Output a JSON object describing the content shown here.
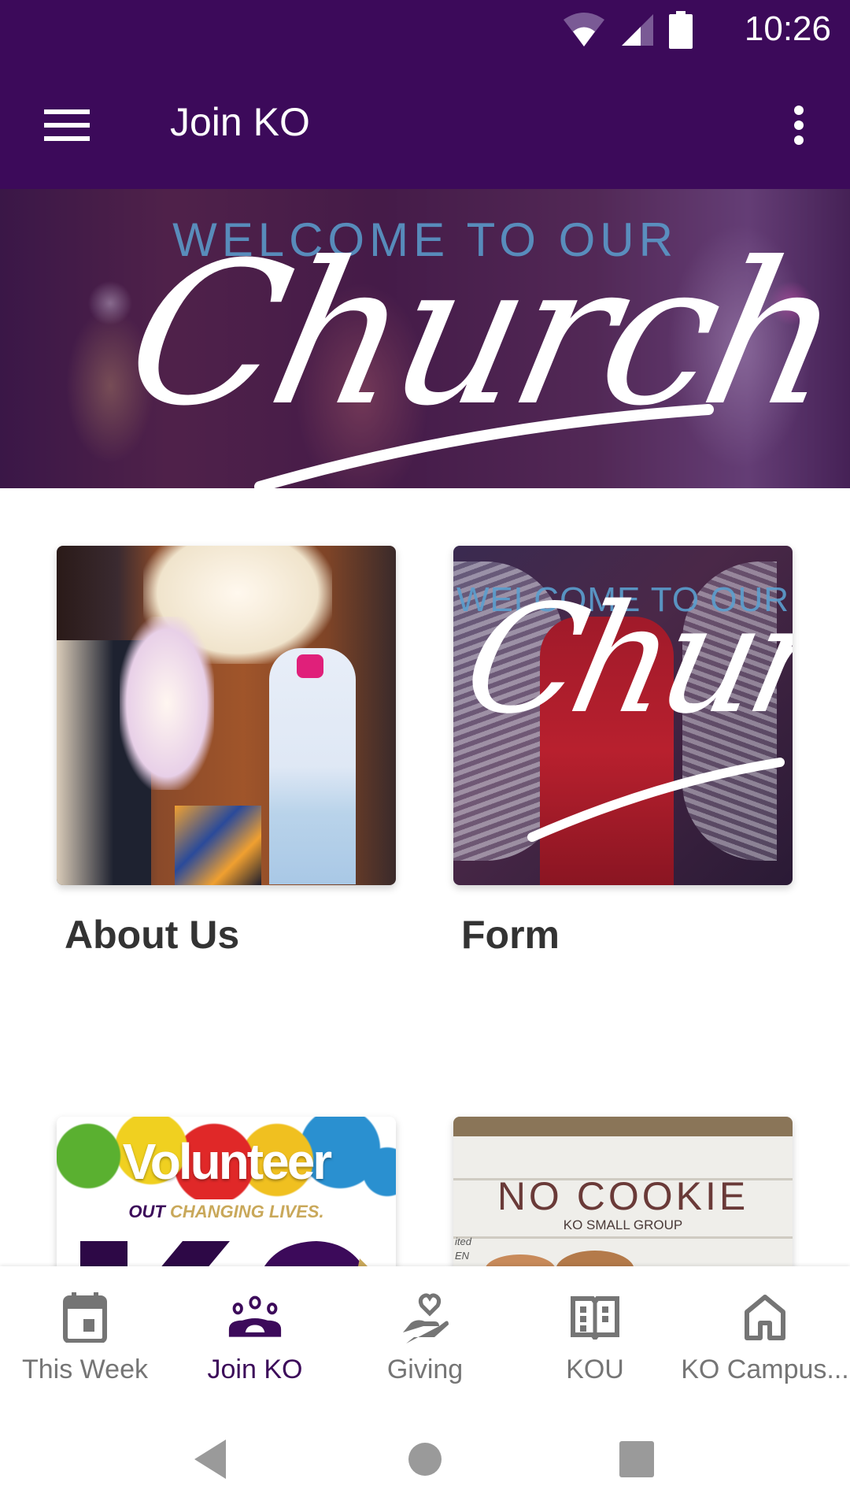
{
  "status_bar": {
    "time": "10:26",
    "icons": [
      "wifi-icon",
      "cellular-signal-icon",
      "battery-icon"
    ]
  },
  "app_bar": {
    "title": "Join KO",
    "menu_icon": "hamburger-menu-icon",
    "overflow_icon": "more-vert-icon"
  },
  "hero": {
    "welcome_text": "WELCOME TO OUR",
    "script_text": "Church"
  },
  "cards": [
    {
      "title": "About Us"
    },
    {
      "title": "Form",
      "image_welcome_text": "WELCOME TO OUR",
      "image_script_text": "Church"
    },
    {
      "title": "",
      "image_heading": "Volunteer",
      "image_tagline_part1": "OUT",
      "image_tagline_part2": "CHANGING LIVES.",
      "image_logo": "KO"
    },
    {
      "title": "",
      "image_heading": "NO COOKIE",
      "image_subheading": "KO SMALL GROUP",
      "image_side_text": [
        "ited",
        "EN"
      ]
    }
  ],
  "bottom_nav": {
    "active_index": 1,
    "active_color": "#3c0a5a",
    "inactive_color": "#757575",
    "items": [
      {
        "label": "This Week",
        "icon": "calendar-icon"
      },
      {
        "label": "Join KO",
        "icon": "groups-icon"
      },
      {
        "label": "Giving",
        "icon": "giving-hand-heart-icon"
      },
      {
        "label": "KOU",
        "icon": "open-book-icon"
      },
      {
        "label": "KO Campus...",
        "icon": "home-icon"
      }
    ]
  },
  "system_nav": {
    "buttons": [
      "back-icon",
      "home-circle-icon",
      "recents-square-icon"
    ]
  },
  "colors": {
    "brand_purple": "#3c0a5a",
    "title_text": "#333333",
    "welcome_blue": "#5b9fcf"
  }
}
